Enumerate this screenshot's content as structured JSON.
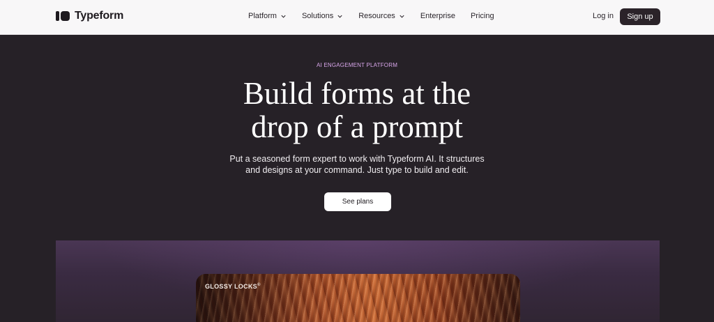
{
  "header": {
    "logo_text": "Typeform",
    "nav": [
      {
        "label": "Platform",
        "has_dropdown": true
      },
      {
        "label": "Solutions",
        "has_dropdown": true
      },
      {
        "label": "Resources",
        "has_dropdown": true
      },
      {
        "label": "Enterprise",
        "has_dropdown": false
      },
      {
        "label": "Pricing",
        "has_dropdown": false
      }
    ],
    "login_label": "Log in",
    "signup_label": "Sign up"
  },
  "hero": {
    "eyebrow": "AI ENGAGEMENT PLATFORM",
    "headline_line1": "Build forms at the",
    "headline_line2": "drop of a prompt",
    "subtext_line1": "Put a seasoned form expert to work with Typeform AI. It structures",
    "subtext_line2": "and designs at your command. Just type to build and edit.",
    "cta_label": "See plans"
  },
  "media": {
    "card_label": "GLOSSY LOCKS",
    "card_label_mark": "©"
  },
  "colors": {
    "hero_bg": "#262127",
    "header_bg": "#f8f7f8",
    "eyebrow": "#d8a6ea",
    "signup_bg": "#2b2329"
  },
  "icons": [
    "typeform-logo-icon",
    "chevron-down-icon"
  ]
}
